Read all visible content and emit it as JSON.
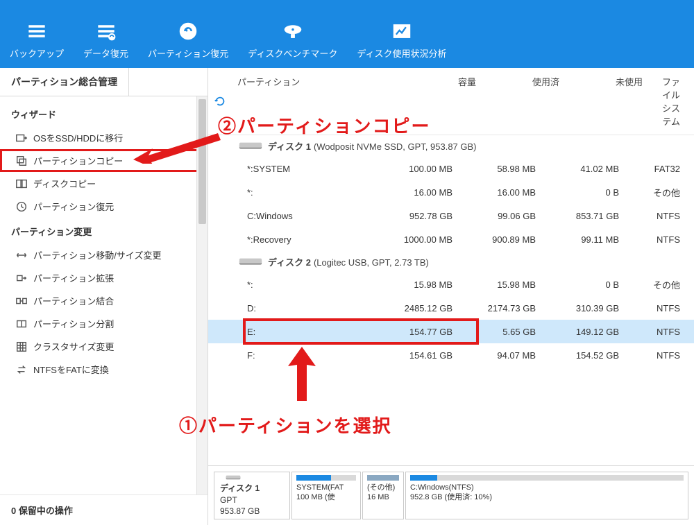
{
  "toolbar": {
    "items": [
      {
        "label": "バックアップ"
      },
      {
        "label": "データ復元"
      },
      {
        "label": "パーティション復元"
      },
      {
        "label": "ディスクベンチマーク"
      },
      {
        "label": "ディスク使用状況分析"
      }
    ]
  },
  "tab_label": "パーティション総合管理",
  "sidebar": {
    "section1": "ウィザード",
    "wizard": [
      "OSをSSD/HDDに移行",
      "パーティションコピー",
      "ディスクコピー",
      "パーティション復元"
    ],
    "section2": "パーティション変更",
    "change": [
      "パーティション移動/サイズ変更",
      "パーティション拡張",
      "パーティション結合",
      "パーティション分割",
      "クラスタサイズ変更",
      "NTFSをFATに変換"
    ],
    "pending": "0 保留中の操作"
  },
  "table": {
    "headers": {
      "partition": "パーティション",
      "capacity": "容量",
      "used": "使用済",
      "free": "未使用",
      "fs": "ファイルシステム"
    },
    "disk1": {
      "name": "ディスク 1",
      "desc": "(Wodposit NVMe SSD, GPT, 953.87 GB)"
    },
    "disk1_rows": [
      {
        "part": "*:SYSTEM",
        "cap": "100.00 MB",
        "used": "58.98 MB",
        "free": "41.02 MB",
        "fs": "FAT32"
      },
      {
        "part": "*:",
        "cap": "16.00 MB",
        "used": "16.00 MB",
        "free": "0 B",
        "fs": "その他"
      },
      {
        "part": "C:Windows",
        "cap": "952.78 GB",
        "used": "99.06 GB",
        "free": "853.71 GB",
        "fs": "NTFS"
      },
      {
        "part": "*:Recovery",
        "cap": "1000.00 MB",
        "used": "900.89 MB",
        "free": "99.11 MB",
        "fs": "NTFS"
      }
    ],
    "disk2": {
      "name": "ディスク 2",
      "desc": "(Logitec USB, GPT, 2.73 TB)"
    },
    "disk2_rows": [
      {
        "part": "*:",
        "cap": "15.98 MB",
        "used": "15.98 MB",
        "free": "0 B",
        "fs": "その他"
      },
      {
        "part": "D:",
        "cap": "2485.12 GB",
        "used": "2174.73 GB",
        "free": "310.39 GB",
        "fs": "NTFS"
      },
      {
        "part": "E:",
        "cap": "154.77 GB",
        "used": "5.65 GB",
        "free": "149.12 GB",
        "fs": "NTFS"
      },
      {
        "part": "F:",
        "cap": "154.61 GB",
        "used": "94.07 MB",
        "free": "154.52 GB",
        "fs": "NTFS"
      }
    ]
  },
  "diskmap": {
    "disk_name": "ディスク 1",
    "disk_type": "GPT",
    "disk_size": "953.87 GB",
    "seg1_name": "SYSTEM(FAT",
    "seg1_sub": "100 MB (使",
    "seg2_name": "(その他)",
    "seg2_sub": "16 MB",
    "seg3_name": "C:Windows(NTFS)",
    "seg3_sub": "952.8 GB (使用済: 10%)"
  },
  "annotations": {
    "a1": "①パーティションを選択",
    "a2": "②パーティションコピー"
  }
}
